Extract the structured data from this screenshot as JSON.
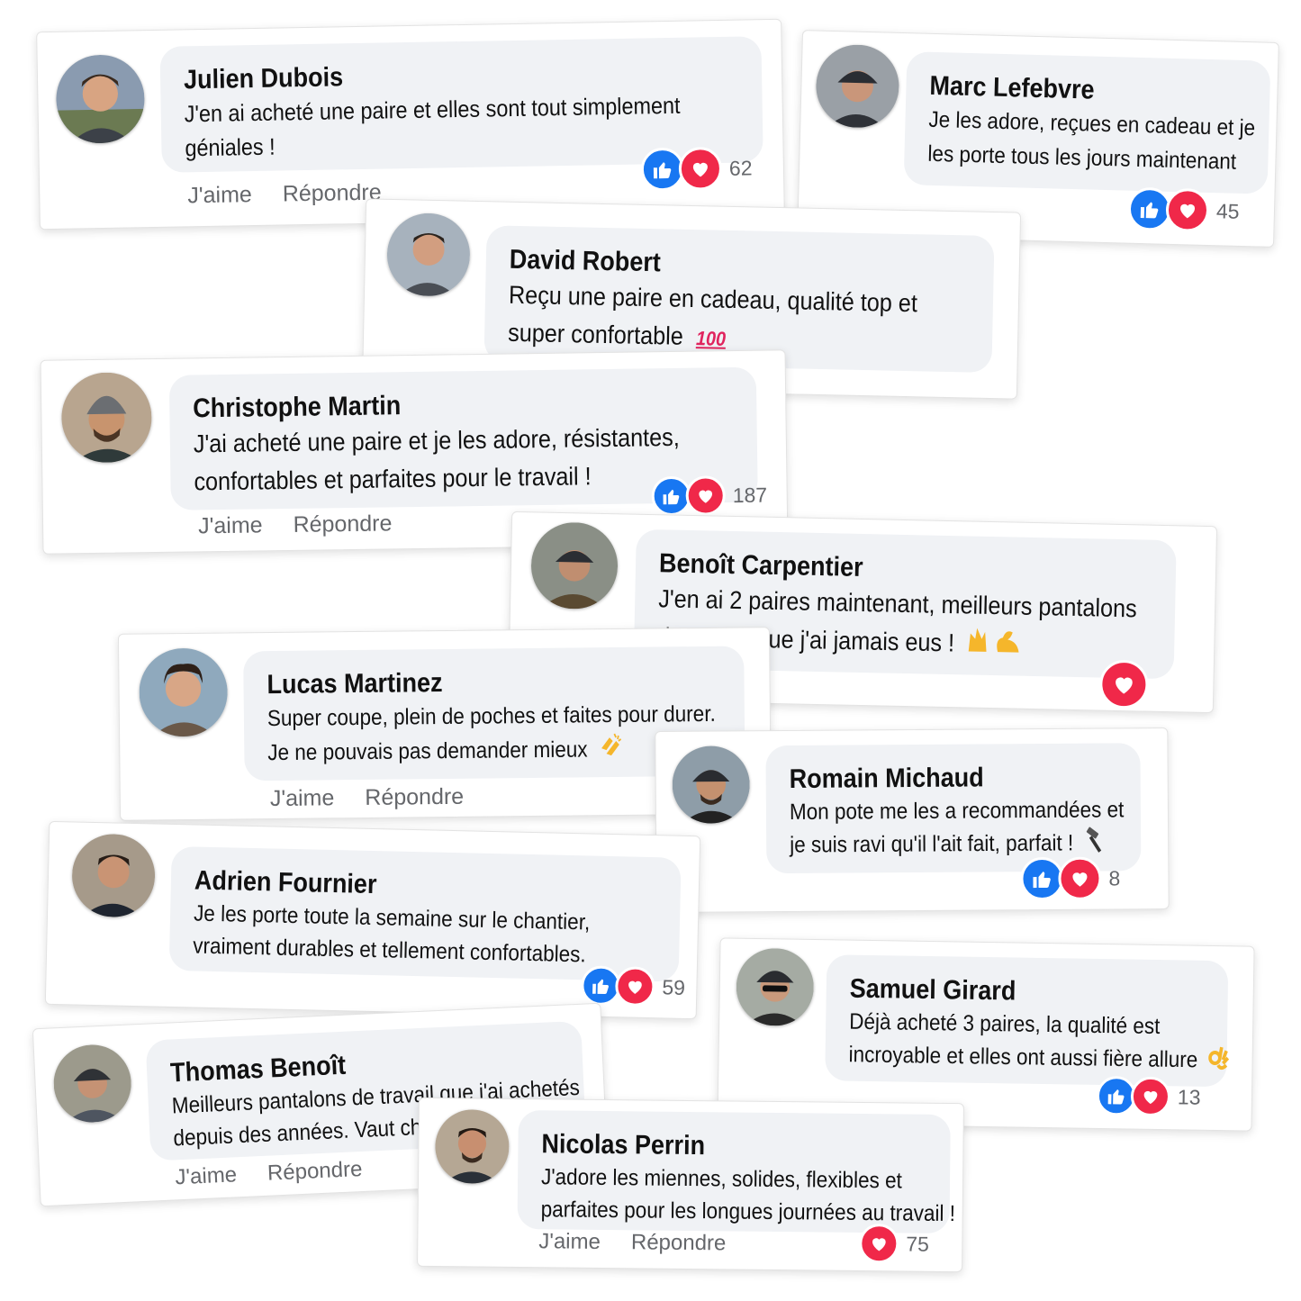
{
  "colors": {
    "like": "#1877f2",
    "love": "#f02849",
    "bubble": "#f0f2f5",
    "muted": "#65676b"
  },
  "actions": {
    "like": "J'aime",
    "reply": "Répondre"
  },
  "comments": [
    {
      "name": "Julien Dubois",
      "lines": [
        "J'en ai acheté une paire et elles sont tout simplement",
        "géniales !"
      ],
      "count": "62"
    },
    {
      "name": "Marc Lefebvre",
      "lines": [
        "Je les adore, reçues en cadeau et je",
        "les porte tous les jours maintenant"
      ],
      "count": "45"
    },
    {
      "name": "David Robert",
      "lines": [
        "Reçu une paire en cadeau, qualité top et",
        "super confortable"
      ],
      "emoji": "hundred-points-icon"
    },
    {
      "name": "Christophe Martin",
      "lines": [
        "J'ai acheté une paire et je les adore, résistantes,",
        "confortables et parfaites pour le travail !"
      ],
      "count": "187"
    },
    {
      "name": "Benoît Carpentier",
      "lines": [
        "J'en ai 2 paires maintenant, meilleurs pantalons",
        "de travail que j'ai jamais eus !"
      ],
      "emoji": "raised-hands-flexed-biceps-icon"
    },
    {
      "name": "Lucas Martinez",
      "lines": [
        "Super coupe, plein de poches et faites pour durer.",
        "Je ne pouvais pas demander mieux"
      ],
      "emoji": "clapping-hands-icon"
    },
    {
      "name": "Romain Michaud",
      "lines": [
        "Mon pote me les a recommandées et",
        "je suis ravi qu'il l'ait fait, parfait !"
      ],
      "emoji": "hammer-icon",
      "count": "8"
    },
    {
      "name": "Adrien Fournier",
      "lines": [
        "Je les porte toute la semaine sur le chantier,",
        "vraiment durables et tellement confortables."
      ],
      "count": "59"
    },
    {
      "name": "Samuel Girard",
      "lines": [
        "Déjà acheté 3 paires, la qualité est",
        "incroyable et elles ont aussi fière allure"
      ],
      "emoji": "ok-hand-icon",
      "count": "13"
    },
    {
      "name": "Thomas Benoît",
      "lines": [
        "Meilleurs pantalons de travail que j'ai achetés",
        "depuis des années. Vaut ch"
      ]
    },
    {
      "name": "Nicolas Perrin",
      "lines": [
        "J'adore les miennes, solides, flexibles et",
        "parfaites pour les longues journées au travail !"
      ],
      "count": "75"
    }
  ]
}
